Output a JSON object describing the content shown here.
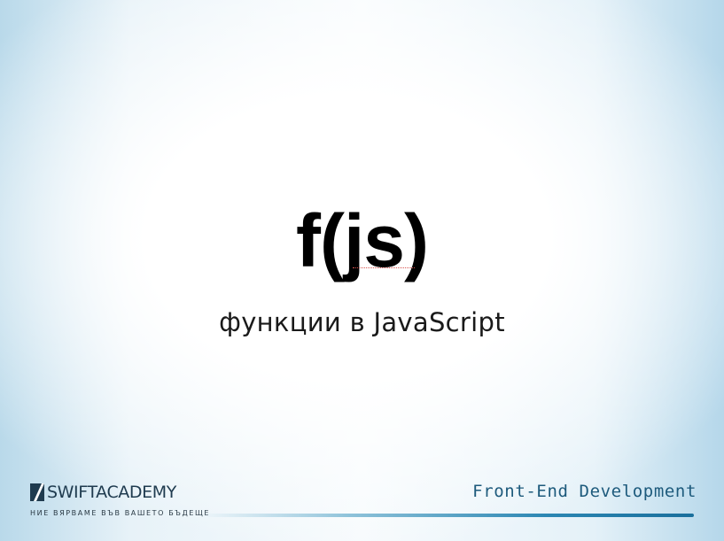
{
  "slide": {
    "title": "f(js)",
    "subtitle": "функции в JavaScript"
  },
  "footer": {
    "logo_name": "SWIFTACADEMY",
    "logo_tagline": "НИЕ ВЯРВАМЕ ВЪВ ВАШЕТО БЪДЕЩЕ",
    "track": "Front-End  Development"
  },
  "icons": {
    "logo_mark": "swift-academy-logo-icon"
  },
  "colors": {
    "logo": "#1f3b4f",
    "track_text": "#1d5a7c",
    "accent_line": "#2c87b3",
    "spellcheck": "#d9534f"
  }
}
